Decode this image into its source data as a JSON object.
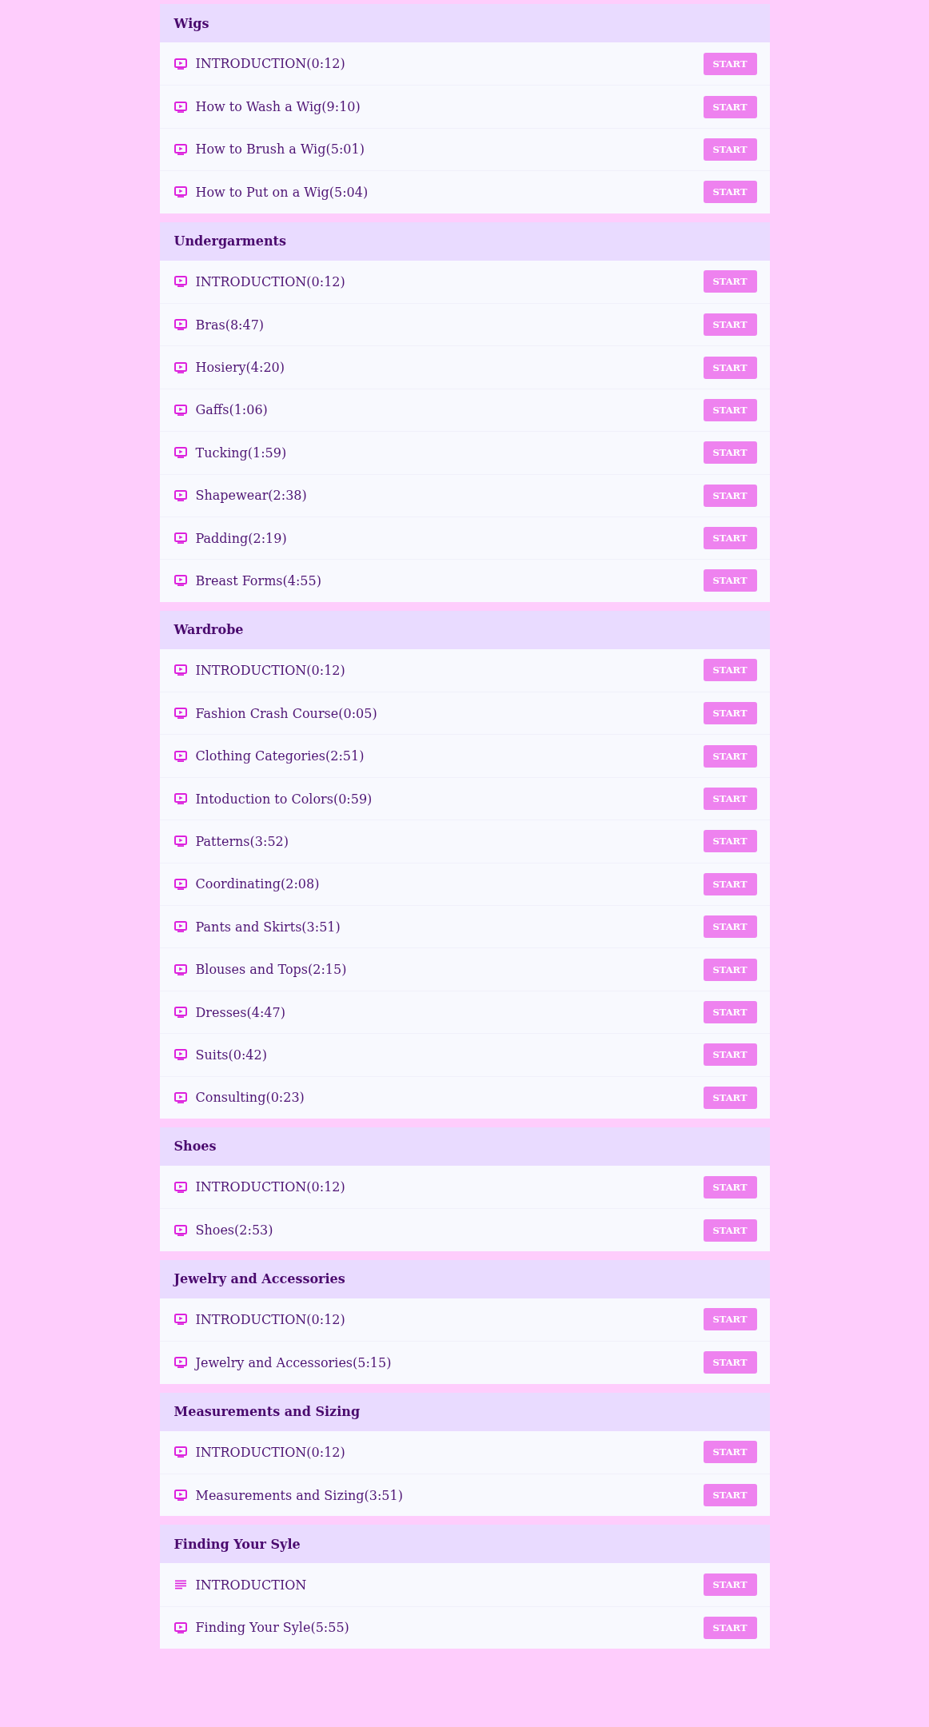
{
  "sections": [
    {
      "title": "Wigs",
      "lessons": [
        {
          "kind": "video",
          "title": "INTRODUCTION(0:12)",
          "action": "START"
        },
        {
          "kind": "video",
          "title": "How to Wash a Wig(9:10)",
          "action": "START"
        },
        {
          "kind": "video",
          "title": "How to Brush a Wig(5:01)",
          "action": "START"
        },
        {
          "kind": "video",
          "title": "How to Put on a Wig(5:04)",
          "action": "START"
        }
      ]
    },
    {
      "title": "Undergarments",
      "lessons": [
        {
          "kind": "video",
          "title": "INTRODUCTION(0:12)",
          "action": "START"
        },
        {
          "kind": "video",
          "title": "Bras(8:47)",
          "action": "START"
        },
        {
          "kind": "video",
          "title": "Hosiery(4:20)",
          "action": "START"
        },
        {
          "kind": "video",
          "title": "Gaffs(1:06)",
          "action": "START"
        },
        {
          "kind": "video",
          "title": "Tucking(1:59)",
          "action": "START"
        },
        {
          "kind": "video",
          "title": "Shapewear(2:38)",
          "action": "START"
        },
        {
          "kind": "video",
          "title": "Padding(2:19)",
          "action": "START"
        },
        {
          "kind": "video",
          "title": "Breast Forms(4:55)",
          "action": "START"
        }
      ]
    },
    {
      "title": "Wardrobe",
      "lessons": [
        {
          "kind": "video",
          "title": "INTRODUCTION(0:12)",
          "action": "START"
        },
        {
          "kind": "video",
          "title": "Fashion Crash Course(0:05)",
          "action": "START"
        },
        {
          "kind": "video",
          "title": "Clothing Categories(2:51)",
          "action": "START"
        },
        {
          "kind": "video",
          "title": "Intoduction to Colors(0:59)",
          "action": "START"
        },
        {
          "kind": "video",
          "title": "Patterns(3:52)",
          "action": "START"
        },
        {
          "kind": "video",
          "title": "Coordinating(2:08)",
          "action": "START"
        },
        {
          "kind": "video",
          "title": "Pants and Skirts(3:51)",
          "action": "START"
        },
        {
          "kind": "video",
          "title": "Blouses and Tops(2:15)",
          "action": "START"
        },
        {
          "kind": "video",
          "title": "Dresses(4:47)",
          "action": "START"
        },
        {
          "kind": "video",
          "title": "Suits(0:42)",
          "action": "START"
        },
        {
          "kind": "video",
          "title": "Consulting(0:23)",
          "action": "START"
        }
      ]
    },
    {
      "title": "Shoes",
      "lessons": [
        {
          "kind": "video",
          "title": "INTRODUCTION(0:12)",
          "action": "START"
        },
        {
          "kind": "video",
          "title": "Shoes(2:53)",
          "action": "START"
        }
      ]
    },
    {
      "title": "Jewelry and Accessories",
      "lessons": [
        {
          "kind": "video",
          "title": "INTRODUCTION(0:12)",
          "action": "START"
        },
        {
          "kind": "video",
          "title": "Jewelry and Accessories(5:15)",
          "action": "START"
        }
      ]
    },
    {
      "title": "Measurements and Sizing",
      "lessons": [
        {
          "kind": "video",
          "title": "INTRODUCTION(0:12)",
          "action": "START"
        },
        {
          "kind": "video",
          "title": "Measurements and Sizing(3:51)",
          "action": "START"
        }
      ]
    },
    {
      "title": "Finding Your Syle",
      "lessons": [
        {
          "kind": "text",
          "title": "INTRODUCTION",
          "action": "START"
        },
        {
          "kind": "video",
          "title": "Finding Your Syle(5:55)",
          "action": "START"
        }
      ]
    }
  ]
}
